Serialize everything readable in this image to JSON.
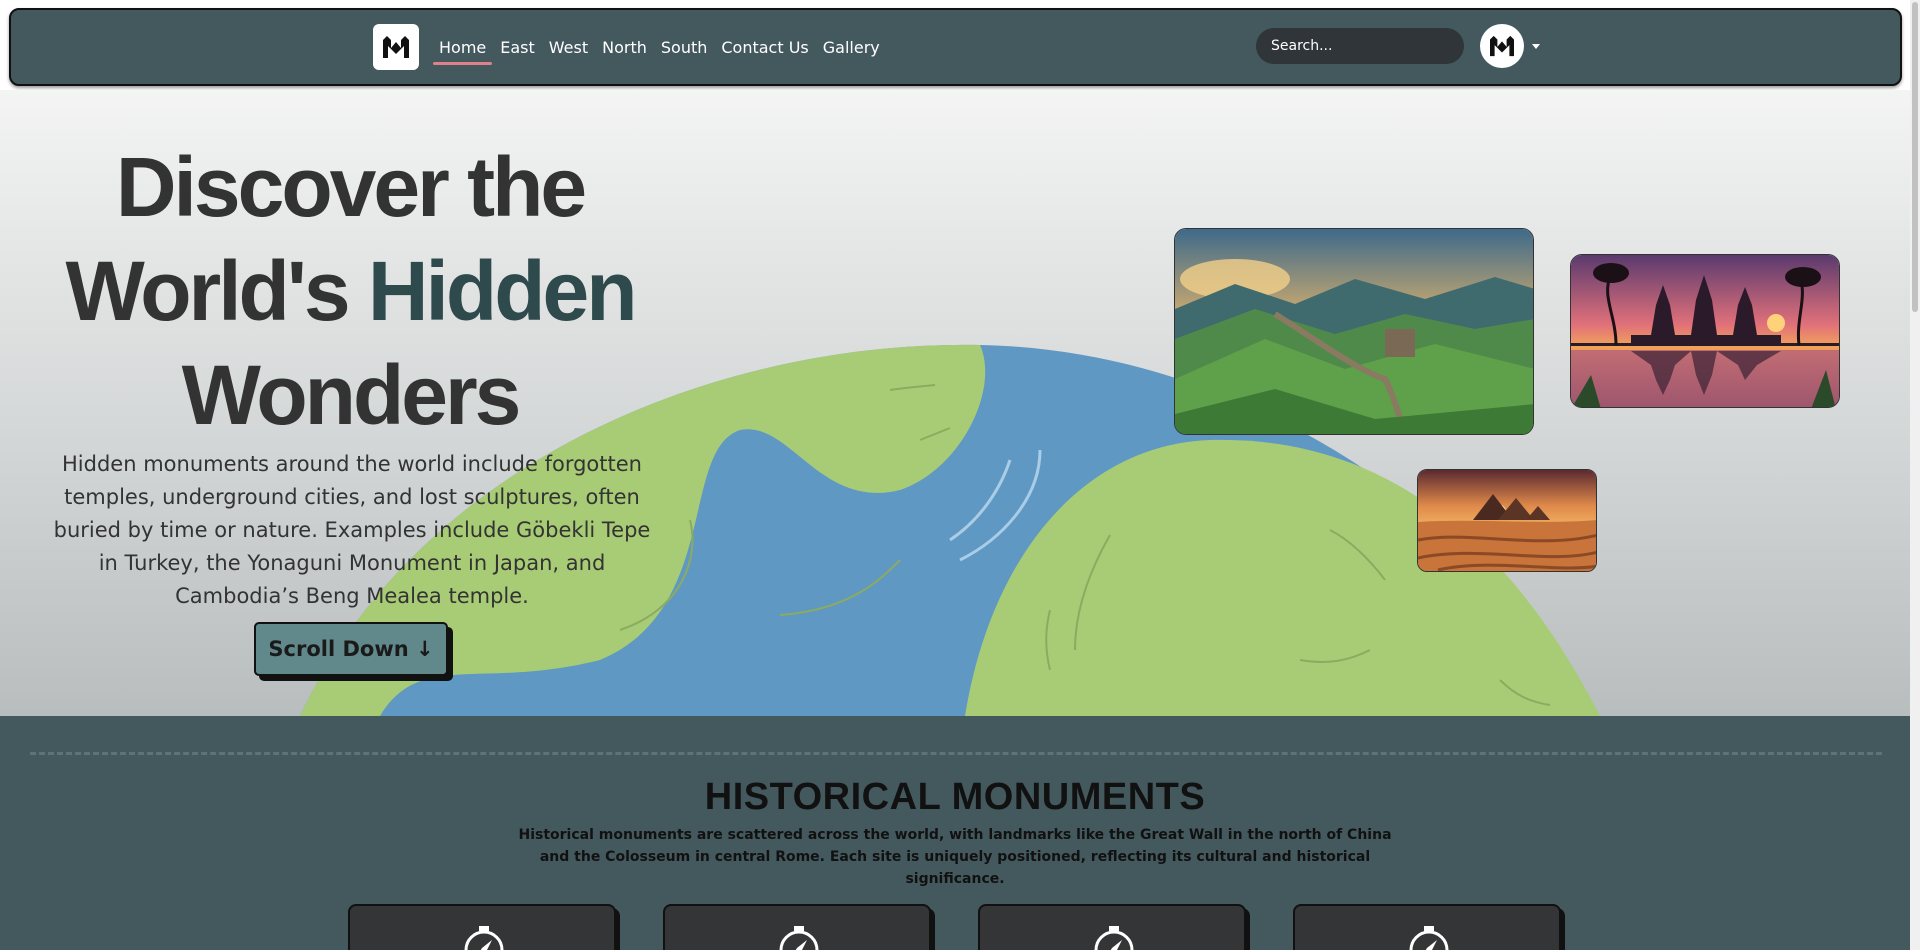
{
  "nav": {
    "logo_text": "M",
    "links": [
      "Home",
      "East",
      "West",
      "North",
      "South",
      "Contact Us",
      "Gallery"
    ],
    "active_index": 0,
    "search_placeholder": "Search..."
  },
  "hero": {
    "title_line1": "Discover the",
    "title_line2_a": "World's ",
    "title_line2_b": "Hidden",
    "title_line3": "Wonders",
    "description": "Hidden monuments around the world include forgotten temples, underground cities, and lost sculptures, often buried by time or nature. Examples include Göbekli Tepe in Turkey, the Yonaguni Monument in Japan, and Cambodia’s Beng Mealea temple.",
    "scroll_button": "Scroll Down ↓",
    "colors": {
      "land": "#a8cc76",
      "water": "#6098c4",
      "accent": "#2f4a4c"
    }
  },
  "section": {
    "title": "HISTORICAL MONUMENTS",
    "description": "Historical monuments are scattered across the world, with landmarks like the Great Wall in the north of China and the Colosseum in central Rome. Each site is uniquely positioned, reflecting its cultural and historical significance.",
    "card_count": 4
  }
}
